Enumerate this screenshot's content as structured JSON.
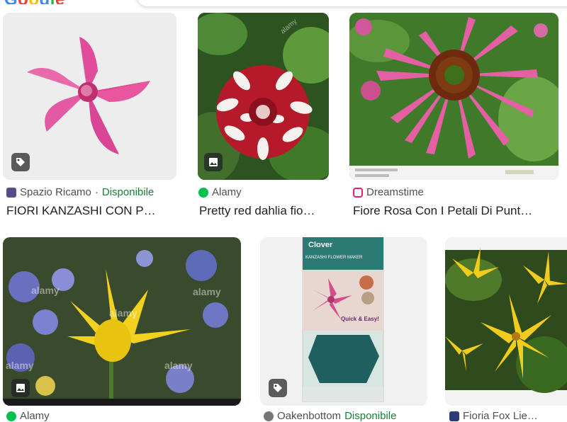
{
  "header": {
    "logo_text": "Google"
  },
  "results": [
    {
      "source": "Spazio Ricamo",
      "sep": "·",
      "availability": "Disponibile",
      "title": "FIORI KANZASHI CON P…",
      "badge": "tag-icon"
    },
    {
      "source": "Alamy",
      "title": "Pretty red dahlia fio…",
      "badge": "image-icon"
    },
    {
      "source": "Dreamstime",
      "title": "Fiore Rosa Con I Petali Di Punt…"
    },
    {
      "source": "Alamy",
      "badge": "image-icon"
    },
    {
      "source": "Oakenbottom",
      "availability": "Disponibile",
      "badge": "tag-icon"
    },
    {
      "source": "Fioria Fox Lie…"
    }
  ],
  "watermarks": {
    "alamy": "alamy",
    "clover": "Clover",
    "kanzashi": "KANZASHI FLOWER MAKER",
    "quick": "Quick & Easy!"
  },
  "colors": {
    "available_green": "#188038",
    "source_gray": "#4d5156",
    "title_text": "#202124"
  }
}
